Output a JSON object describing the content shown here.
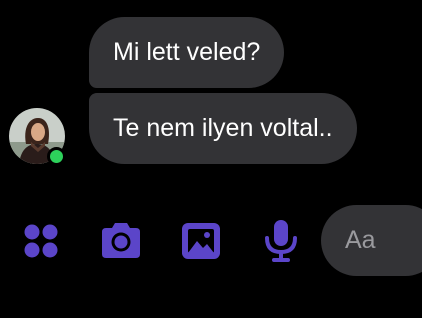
{
  "messages": [
    {
      "text": "Mi lett veled?"
    },
    {
      "text": "Te nem ilyen voltal.."
    }
  ],
  "contact": {
    "avatar_icon": "contact-avatar",
    "presence": "online",
    "presence_color": "#2dd15b"
  },
  "toolbar": {
    "accent_color": "#5b45c9",
    "buttons": [
      {
        "icon": "apps-grid-icon"
      },
      {
        "icon": "camera-icon"
      },
      {
        "icon": "gallery-icon"
      },
      {
        "icon": "microphone-icon"
      }
    ]
  },
  "composer": {
    "placeholder": "Aa",
    "value": ""
  },
  "colors": {
    "background": "#000000",
    "bubble": "#333336",
    "text": "#ffffff",
    "placeholder": "#9a9a9e"
  }
}
